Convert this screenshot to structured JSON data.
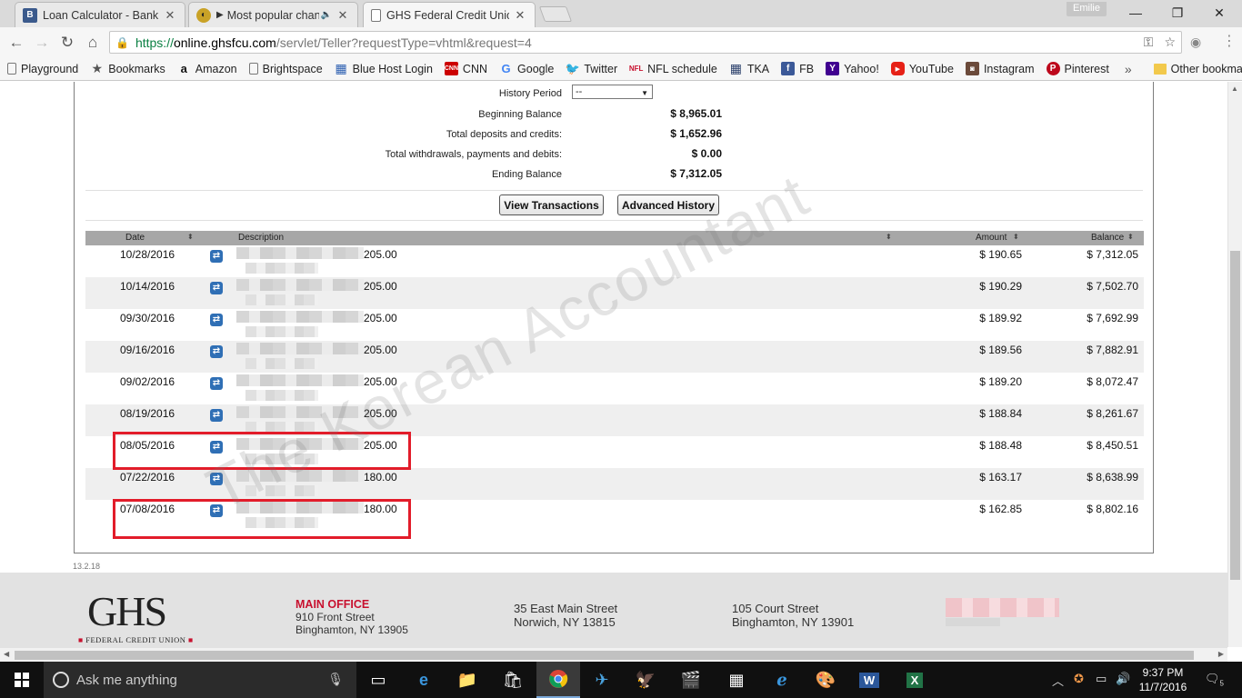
{
  "browser": {
    "tabs": [
      {
        "title": "Loan Calculator - Bankrate",
        "favicon": "B"
      },
      {
        "title": "Most popular chan",
        "favicon": "O"
      },
      {
        "title": "GHS Federal Credit Union",
        "favicon": "doc"
      }
    ],
    "profile": "Emilie",
    "url_scheme": "https://",
    "url_host": "online.ghsfcu.com",
    "url_path": "/servlet/Teller?requestType=vhtml&request=4",
    "bookmarks": [
      {
        "label": "Playground",
        "icon": "doc-icon"
      },
      {
        "label": "Bookmarks",
        "icon": "star-icon"
      },
      {
        "label": "Amazon",
        "icon": "amazon-icon"
      },
      {
        "label": "Brightspace",
        "icon": "doc-icon"
      },
      {
        "label": "Blue Host Login",
        "icon": "grid-icon"
      },
      {
        "label": "CNN",
        "icon": "cnn-icon"
      },
      {
        "label": "Google",
        "icon": "google-icon"
      },
      {
        "label": "Twitter",
        "icon": "twitter-icon"
      },
      {
        "label": "NFL schedule",
        "icon": "nfl-icon"
      },
      {
        "label": "TKA",
        "icon": "grid-icon"
      },
      {
        "label": "FB",
        "icon": "facebook-icon"
      },
      {
        "label": "Yahoo!",
        "icon": "yahoo-icon"
      },
      {
        "label": "YouTube",
        "icon": "youtube-icon"
      },
      {
        "label": "Instagram",
        "icon": "instagram-icon"
      },
      {
        "label": "Pinterest",
        "icon": "pinterest-icon"
      }
    ],
    "bookmarks_more": "»",
    "other_bookmarks": "Other bookmarks"
  },
  "summary": {
    "history_period_label": "History Period",
    "history_period_value": "--",
    "beginning_label": "Beginning Balance",
    "beginning_value": "$ 8,965.01",
    "deposits_label": "Total deposits and credits:",
    "deposits_value": "$ 1,652.96",
    "withdrawals_label": "Total withdrawals, payments and debits:",
    "withdrawals_value": "$ 0.00",
    "ending_label": "Ending Balance",
    "ending_value": "$ 7,312.05"
  },
  "buttons": {
    "view_transactions": "View Transactions",
    "advanced_history": "Advanced History"
  },
  "table": {
    "headers": {
      "date": "Date",
      "description": "Description",
      "amount": "Amount",
      "balance": "Balance"
    },
    "rows": [
      {
        "date": "10/28/2016",
        "desc": "205.00",
        "amount": "$ 190.65",
        "balance": "$ 7,312.05"
      },
      {
        "date": "10/14/2016",
        "desc": "205.00",
        "amount": "$ 190.29",
        "balance": "$ 7,502.70"
      },
      {
        "date": "09/30/2016",
        "desc": "205.00",
        "amount": "$ 189.92",
        "balance": "$ 7,692.99"
      },
      {
        "date": "09/16/2016",
        "desc": "205.00",
        "amount": "$ 189.56",
        "balance": "$ 7,882.91"
      },
      {
        "date": "09/02/2016",
        "desc": "205.00",
        "amount": "$ 189.20",
        "balance": "$ 8,072.47"
      },
      {
        "date": "08/19/2016",
        "desc": "205.00",
        "amount": "$ 188.84",
        "balance": "$ 8,261.67"
      },
      {
        "date": "08/05/2016",
        "desc": "205.00",
        "amount": "$ 188.48",
        "balance": "$ 8,450.51"
      },
      {
        "date": "07/22/2016",
        "desc": "180.00",
        "amount": "$ 163.17",
        "balance": "$ 8,638.99"
      },
      {
        "date": "07/08/2016",
        "desc": "180.00",
        "amount": "$ 162.85",
        "balance": "$ 8,802.16"
      }
    ]
  },
  "watermark": "The Korean Accountant",
  "version": "13.2.18",
  "footer": {
    "logo": "GHS",
    "logo_sub": "FEDERAL CREDIT UNION",
    "main_office_title": "MAIN OFFICE",
    "main_office_line1": "910 Front Street",
    "main_office_line2": "Binghamton, NY 13905",
    "office2_line1": "35 East Main Street",
    "office2_line2": "Norwich, NY 13815",
    "office3_line1": "105 Court Street",
    "office3_line2": "Binghamton, NY 13901"
  },
  "taskbar": {
    "search_placeholder": "Ask me anything",
    "time": "9:37 PM",
    "date": "11/7/2016",
    "notifications": "5"
  },
  "colors": {
    "highlight": "#e21c2a",
    "brand_red": "#c8102e",
    "url_green": "#0b8043"
  }
}
